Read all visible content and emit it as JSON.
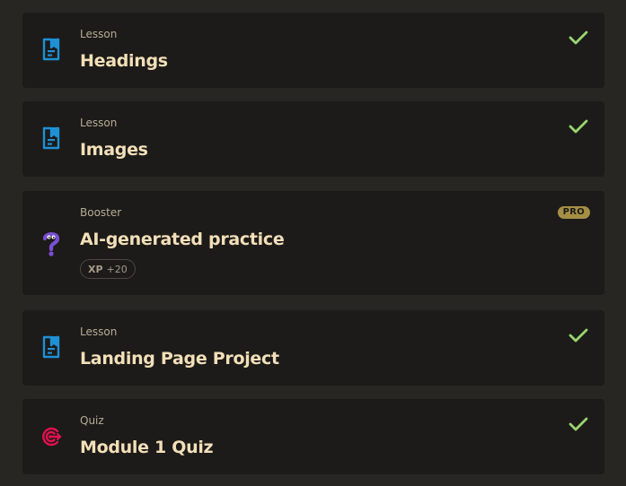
{
  "items": [
    {
      "kind": "Lesson",
      "title": "Headings",
      "icon": "lesson-doc-icon",
      "status": "completed"
    },
    {
      "kind": "Lesson",
      "title": "Images",
      "icon": "lesson-doc-icon",
      "status": "completed"
    },
    {
      "kind": "Booster",
      "title": "AI-generated practice",
      "icon": "booster-creature-icon",
      "badge": "PRO",
      "xp_label": "XP",
      "xp_value": "+20"
    },
    {
      "kind": "Lesson",
      "title": "Landing Page Project",
      "icon": "lesson-doc-icon",
      "status": "completed"
    },
    {
      "kind": "Quiz",
      "title": "Module 1 Quiz",
      "icon": "quiz-target-icon",
      "status": "completed"
    }
  ],
  "colors": {
    "background": "#272622",
    "card": "#1c1b19",
    "title": "#f3dfb8",
    "kind": "#b8ac96",
    "check": "#9ad56f",
    "lesson_icon": "#1e90d6",
    "quiz_icon": "#e3104f",
    "pro_badge": "#a58f45"
  }
}
